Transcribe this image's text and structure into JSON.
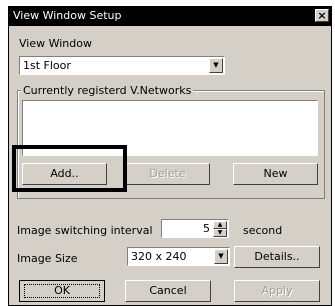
{
  "window": {
    "title": "View Window Setup",
    "close_glyph": "×"
  },
  "view_window": {
    "label": "View Window",
    "selected": "1st Floor"
  },
  "networks": {
    "group_label": "Currently registerd V.Networks",
    "items": []
  },
  "buttons": {
    "add": "Add..",
    "delete": "Delete",
    "new": "New",
    "details": "Details..",
    "ok": "OK",
    "cancel": "Cancel",
    "apply": "Apply"
  },
  "switching": {
    "label": "Image switching interval",
    "value": "5",
    "unit": "second"
  },
  "image_size": {
    "label": "Image Size",
    "selected": "320 x 240"
  },
  "icons": {
    "dropdown": "chevron-down-icon",
    "spin_up": "spin-up-icon",
    "spin_down": "spin-down-icon",
    "close": "close-icon"
  }
}
